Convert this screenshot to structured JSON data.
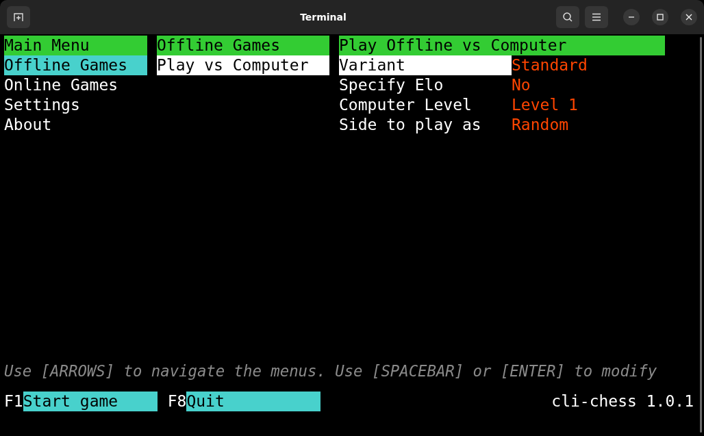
{
  "window": {
    "title": "Terminal"
  },
  "menus": [
    {
      "title": "Main Menu",
      "focused": false,
      "items": [
        {
          "label": "Offline Games",
          "selected": true
        },
        {
          "label": "Online Games",
          "selected": false
        },
        {
          "label": "Settings",
          "selected": false
        },
        {
          "label": "About",
          "selected": false
        }
      ]
    },
    {
      "title": "Offline Games",
      "focused": true,
      "items": [
        {
          "label": "Play vs Computer",
          "selected": true
        }
      ]
    }
  ],
  "options_panel": {
    "title": "Play Offline vs Computer",
    "focused": true,
    "options": [
      {
        "label": "Variant",
        "value": "Standard",
        "selected": true
      },
      {
        "label": "Specify Elo",
        "value": "No",
        "selected": false
      },
      {
        "label": "Computer Level",
        "value": "Level 1",
        "selected": false
      },
      {
        "label": "Side to play as",
        "value": "Random",
        "selected": false
      }
    ]
  },
  "help_text": "Use [ARROWS] to navigate the menus. Use [SPACEBAR] or [ENTER] to modify",
  "function_keys": [
    {
      "key": "F1",
      "label": "Start game"
    },
    {
      "key": "F8",
      "label": "Quit"
    }
  ],
  "version": "cli-chess 1.0.1"
}
